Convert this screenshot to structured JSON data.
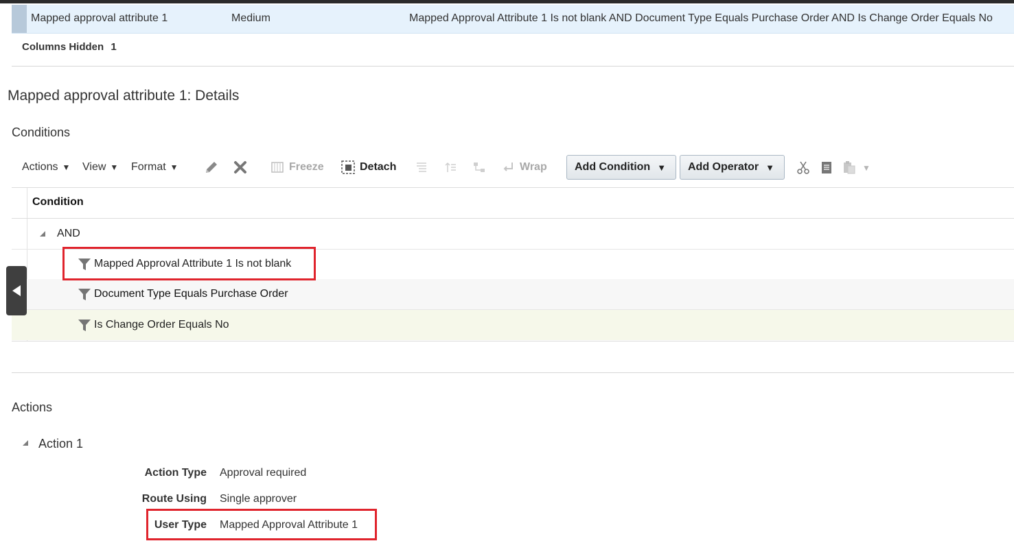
{
  "selected_row": {
    "name": "Mapped approval attribute 1",
    "priority": "Medium",
    "condition": "Mapped Approval Attribute 1 Is not blank AND Document Type Equals Purchase Order AND Is Change Order Equals No"
  },
  "columns_hidden": {
    "label": "Columns Hidden",
    "count": "1"
  },
  "details_title": "Mapped approval attribute 1: Details",
  "conditions": {
    "title": "Conditions",
    "toolbar": {
      "actions": "Actions",
      "view": "View",
      "format": "Format",
      "freeze": "Freeze",
      "detach": "Detach",
      "wrap": "Wrap",
      "add_condition": "Add Condition",
      "add_operator": "Add Operator"
    },
    "table": {
      "header": "Condition",
      "operator": "AND",
      "rows": [
        "Mapped Approval Attribute 1 Is not blank",
        "Document Type Equals Purchase Order",
        "Is Change Order Equals No"
      ]
    }
  },
  "actions": {
    "title": "Actions",
    "action_label": "Action 1",
    "fields": [
      {
        "label": "Action Type",
        "value": "Approval required"
      },
      {
        "label": "Route Using",
        "value": "Single approver"
      },
      {
        "label": "User Type",
        "value": "Mapped Approval Attribute 1"
      }
    ]
  },
  "colors": {
    "highlight_box": "#e0242d",
    "selected_row_bg": "#e6f2fc"
  }
}
